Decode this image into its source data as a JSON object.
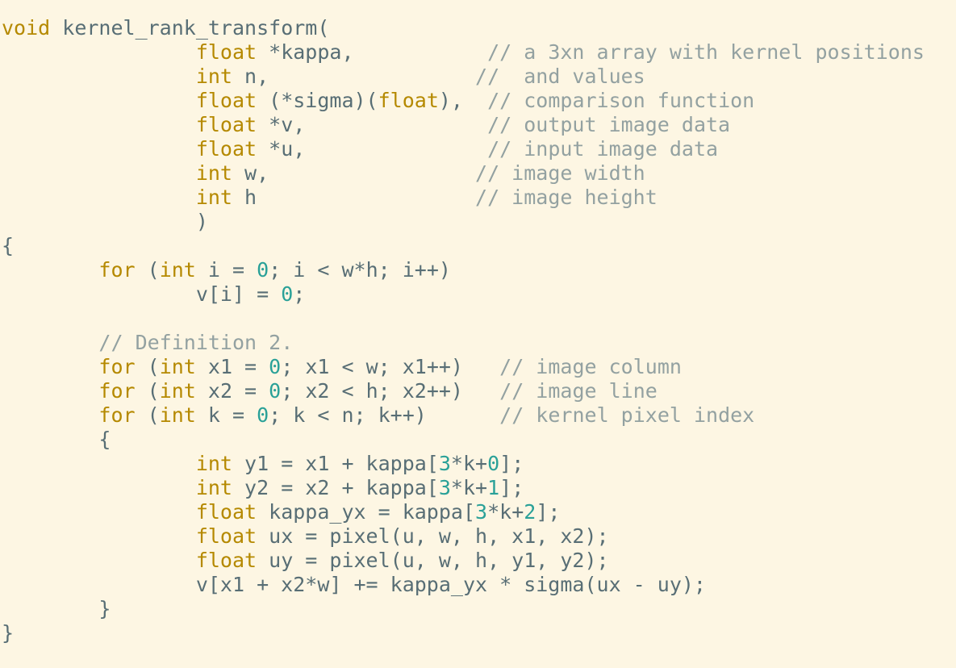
{
  "colors": {
    "background": "#fdf6e3",
    "text": "#586e75",
    "keyword": "#b58900",
    "number": "#2aa198",
    "comment": "#93a1a1"
  },
  "lines": [
    [
      [
        "kw",
        "void"
      ],
      [
        "t",
        " kernel_rank_transform("
      ]
    ],
    [
      [
        "t",
        "                "
      ],
      [
        "kw",
        "float"
      ],
      [
        "t",
        " *kappa,           "
      ],
      [
        "cm",
        "// a 3xn array with kernel positions"
      ]
    ],
    [
      [
        "t",
        "                "
      ],
      [
        "kw",
        "int"
      ],
      [
        "t",
        " n,                 "
      ],
      [
        "cm",
        "//  and values"
      ]
    ],
    [
      [
        "t",
        "                "
      ],
      [
        "kw",
        "float"
      ],
      [
        "t",
        " (*sigma)("
      ],
      [
        "kw",
        "float"
      ],
      [
        "t",
        "),  "
      ],
      [
        "cm",
        "// comparison function"
      ]
    ],
    [
      [
        "t",
        "                "
      ],
      [
        "kw",
        "float"
      ],
      [
        "t",
        " *v,               "
      ],
      [
        "cm",
        "// output image data"
      ]
    ],
    [
      [
        "t",
        "                "
      ],
      [
        "kw",
        "float"
      ],
      [
        "t",
        " *u,               "
      ],
      [
        "cm",
        "// input image data"
      ]
    ],
    [
      [
        "t",
        "                "
      ],
      [
        "kw",
        "int"
      ],
      [
        "t",
        " w,                 "
      ],
      [
        "cm",
        "// image width"
      ]
    ],
    [
      [
        "t",
        "                "
      ],
      [
        "kw",
        "int"
      ],
      [
        "t",
        " h                  "
      ],
      [
        "cm",
        "// image height"
      ]
    ],
    [
      [
        "t",
        "                )"
      ]
    ],
    [
      [
        "t",
        "{"
      ]
    ],
    [
      [
        "t",
        "        "
      ],
      [
        "kw",
        "for"
      ],
      [
        "t",
        " ("
      ],
      [
        "kw",
        "int"
      ],
      [
        "t",
        " i = "
      ],
      [
        "num",
        "0"
      ],
      [
        "t",
        "; i < w*h; i++)"
      ]
    ],
    [
      [
        "t",
        "                v[i] = "
      ],
      [
        "num",
        "0"
      ],
      [
        "t",
        ";"
      ]
    ],
    [],
    [
      [
        "t",
        "        "
      ],
      [
        "cm",
        "// Definition 2."
      ]
    ],
    [
      [
        "t",
        "        "
      ],
      [
        "kw",
        "for"
      ],
      [
        "t",
        " ("
      ],
      [
        "kw",
        "int"
      ],
      [
        "t",
        " x1 = "
      ],
      [
        "num",
        "0"
      ],
      [
        "t",
        "; x1 < w; x1++)   "
      ],
      [
        "cm",
        "// image column"
      ]
    ],
    [
      [
        "t",
        "        "
      ],
      [
        "kw",
        "for"
      ],
      [
        "t",
        " ("
      ],
      [
        "kw",
        "int"
      ],
      [
        "t",
        " x2 = "
      ],
      [
        "num",
        "0"
      ],
      [
        "t",
        "; x2 < h; x2++)   "
      ],
      [
        "cm",
        "// image line"
      ]
    ],
    [
      [
        "t",
        "        "
      ],
      [
        "kw",
        "for"
      ],
      [
        "t",
        " ("
      ],
      [
        "kw",
        "int"
      ],
      [
        "t",
        " k = "
      ],
      [
        "num",
        "0"
      ],
      [
        "t",
        "; k < n; k++)      "
      ],
      [
        "cm",
        "// kernel pixel index"
      ]
    ],
    [
      [
        "t",
        "        {"
      ]
    ],
    [
      [
        "t",
        "                "
      ],
      [
        "kw",
        "int"
      ],
      [
        "t",
        " y1 = x1 + kappa["
      ],
      [
        "num",
        "3"
      ],
      [
        "t",
        "*k+"
      ],
      [
        "num",
        "0"
      ],
      [
        "t",
        "];"
      ]
    ],
    [
      [
        "t",
        "                "
      ],
      [
        "kw",
        "int"
      ],
      [
        "t",
        " y2 = x2 + kappa["
      ],
      [
        "num",
        "3"
      ],
      [
        "t",
        "*k+"
      ],
      [
        "num",
        "1"
      ],
      [
        "t",
        "];"
      ]
    ],
    [
      [
        "t",
        "                "
      ],
      [
        "kw",
        "float"
      ],
      [
        "t",
        " kappa_yx = kappa["
      ],
      [
        "num",
        "3"
      ],
      [
        "t",
        "*k+"
      ],
      [
        "num",
        "2"
      ],
      [
        "t",
        "];"
      ]
    ],
    [
      [
        "t",
        "                "
      ],
      [
        "kw",
        "float"
      ],
      [
        "t",
        " ux = pixel(u, w, h, x1, x2);"
      ]
    ],
    [
      [
        "t",
        "                "
      ],
      [
        "kw",
        "float"
      ],
      [
        "t",
        " uy = pixel(u, w, h, y1, y2);"
      ]
    ],
    [
      [
        "t",
        "                v[x1 + x2*w] += kappa_yx * sigma(ux - uy);"
      ]
    ],
    [
      [
        "t",
        "        }"
      ]
    ],
    [
      [
        "t",
        "}"
      ]
    ]
  ]
}
